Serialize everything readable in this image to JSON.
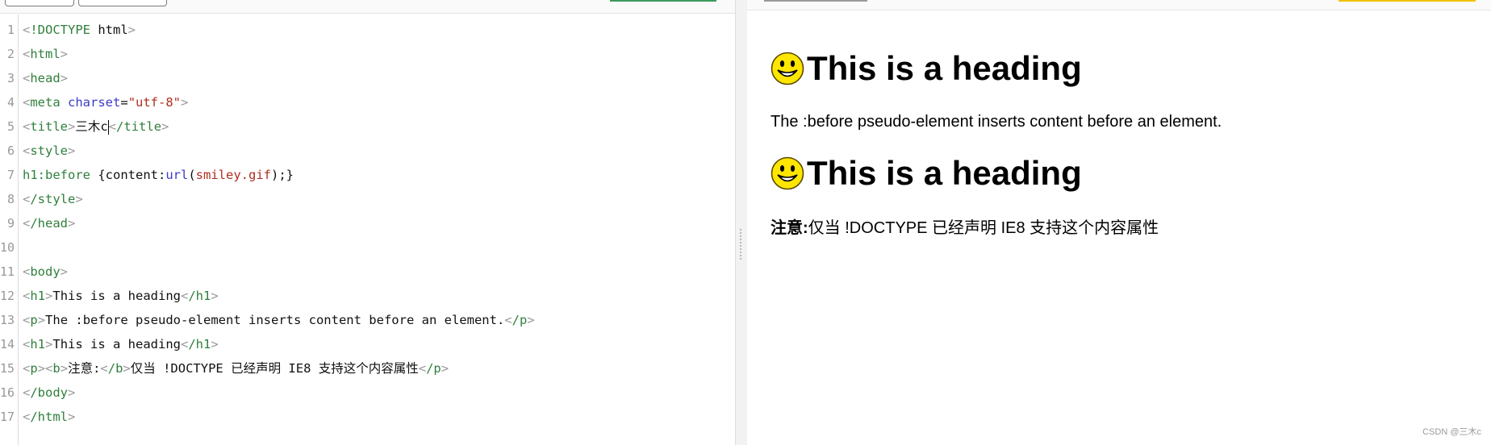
{
  "editor": {
    "line_numbers": [
      "1",
      "2",
      "3",
      "4",
      "5",
      "6",
      "7",
      "8",
      "9",
      "10",
      "11",
      "12",
      "13",
      "14",
      "15",
      "16",
      "17"
    ],
    "code_lines": [
      "<!DOCTYPE html>",
      "<html>",
      "<head>",
      "<meta charset=\"utf-8\">",
      "<title>三木c</title>",
      "<style>",
      "h1:before {content:url(smiley.gif);}",
      "</style>",
      "</head>",
      "",
      "<body>",
      "<h1>This is a heading</h1>",
      "<p>The :before pseudo-element inserts content before an element.</p>",
      "<h1>This is a heading</h1>",
      "<p><b>注意:</b>仅当 !DOCTYPE 已经声明 IE8 支持这个内容属性</p>",
      "</body>",
      "</html>"
    ]
  },
  "preview": {
    "heading1": "This is a heading",
    "paragraph1": "The :before pseudo-element inserts content before an element.",
    "heading2": "This is a heading",
    "note_label": "注意:",
    "note_text": "仅当 !DOCTYPE 已经声明 IE8 支持这个内容属性",
    "smiley_icon": "smiley-face-icon"
  },
  "watermark": "CSDN @三木c",
  "colors": {
    "tag": "#2f7f3c",
    "attribute": "#3b3bc8",
    "string": "#b22d1f",
    "run_bar": "#3c9a5f",
    "highlight_bar": "#f2c200"
  }
}
